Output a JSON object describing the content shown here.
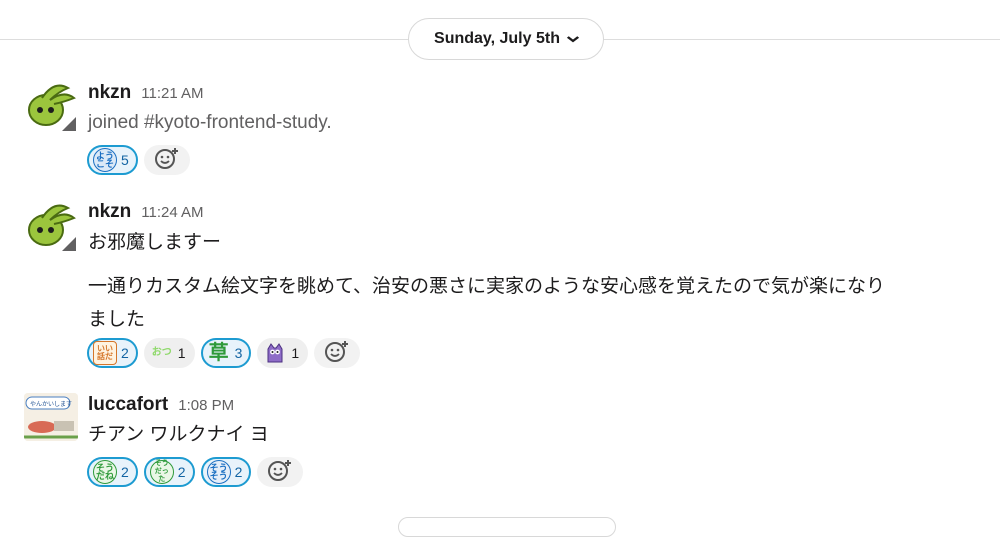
{
  "date_divider": {
    "label": "Sunday, July 5th"
  },
  "messages": [
    {
      "author": "nkzn",
      "time": "11:21 AM",
      "lines": [
        "joined #kyoto-frontend-study."
      ],
      "reactions": [
        {
          "emoji_text": "ようこそ",
          "emoji": "youkoso-emoji",
          "count": "5",
          "active": true
        }
      ]
    },
    {
      "author": "nkzn",
      "time": "11:24 AM",
      "lines": [
        "お邪魔しますー",
        "一通りカスタム絵文字を眺めて、治安の悪さに実家のような安心感を覚えたので気が楽になり",
        "ました"
      ],
      "reactions": [
        {
          "emoji_text": "いい話だ",
          "emoji": "iihanashida-emoji",
          "count": "2",
          "active": true
        },
        {
          "emoji_text": "おつ",
          "emoji": "otsu-emoji",
          "count": "1",
          "active": false
        },
        {
          "emoji_text": "草",
          "emoji": "kusa-emoji",
          "count": "3",
          "active": true
        },
        {
          "emoji_text": "",
          "emoji": "purple-creature-emoji",
          "count": "1",
          "active": false
        }
      ]
    },
    {
      "author": "luccafort",
      "time": "1:08 PM",
      "lines": [
        "チアン ワルクナイ ヨ"
      ],
      "avatar_caption": "やんかいします",
      "reactions": [
        {
          "emoji_text": "そうだね",
          "emoji": "soudane-emoji",
          "count": "2",
          "active": true
        },
        {
          "emoji_text": "そうだった",
          "emoji": "soudatta-emoji",
          "count": "2",
          "active": true
        },
        {
          "emoji_text": "そうそう",
          "emoji": "sousou-emoji",
          "count": "2",
          "active": true
        }
      ]
    }
  ],
  "colors": {
    "accent": "#1d9bd1",
    "reaction_active_bg": "#e8f3fb",
    "text_muted": "#616061"
  }
}
